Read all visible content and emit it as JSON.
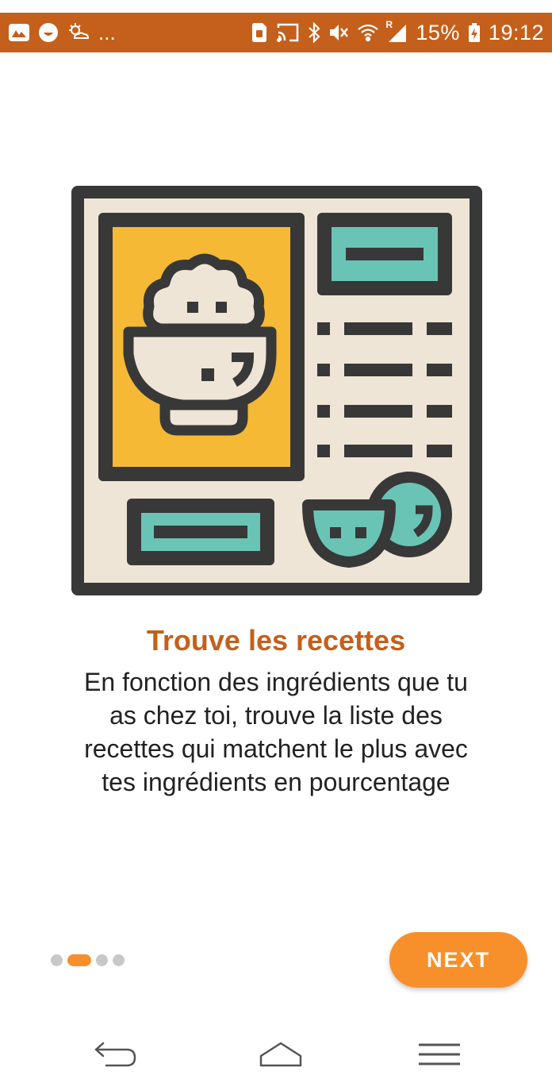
{
  "colors": {
    "status_bar": "#c4601b",
    "accent": "#f7902a",
    "title": "#c4601b",
    "illustration_dark": "#383838",
    "illustration_cream": "#efe5d6",
    "illustration_yellow": "#f5b935",
    "illustration_teal": "#6ac4b5"
  },
  "status_bar": {
    "left_icons": [
      "gallery-app-icon",
      "smiley-app-icon",
      "sun-cloud-icon"
    ],
    "overflow": "...",
    "right_icons": [
      "sim-card-icon",
      "cast-icon",
      "bluetooth-icon",
      "mute-icon",
      "wifi-icon",
      "signal-icon"
    ],
    "roaming_mark": "R",
    "battery": "15%",
    "time": "19:12"
  },
  "onboarding": {
    "illustration": "recipe-menu-illustration",
    "title": "Trouve les recettes",
    "description": "En fonction des ingrédients que tu as chez toi, trouve la liste des recettes qui matchent le plus avec tes ingrédients en pourcentage",
    "pager": {
      "total": 4,
      "current": 2
    },
    "next_label": "NEXT"
  },
  "nav_bar": {
    "icons": [
      "back-icon",
      "home-icon",
      "menu-icon"
    ]
  }
}
